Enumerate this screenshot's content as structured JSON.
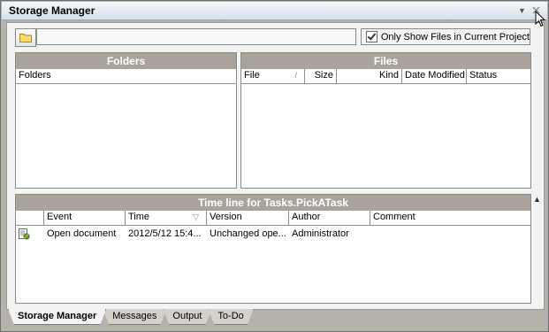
{
  "window": {
    "title": "Storage Manager"
  },
  "toolbar": {
    "path_value": "",
    "checkbox_label": "Only Show Files in Current Project",
    "checkbox_checked": true
  },
  "folders_panel": {
    "title": "Folders",
    "column": "Folders"
  },
  "files_panel": {
    "title": "Files",
    "columns": [
      "File",
      "Size",
      "Kind",
      "Date Modified",
      "Status"
    ]
  },
  "timeline_panel": {
    "title": "Time line for Tasks.PickATask",
    "columns": [
      "Event",
      "Time",
      "Version",
      "Author",
      "Comment"
    ],
    "rows": [
      {
        "icon": "document-edit-icon",
        "event": "Open document",
        "time": "2012/5/12 15:4...",
        "version": "Unchanged ope...",
        "author": "Administrator",
        "comment": ""
      }
    ]
  },
  "tabs": [
    {
      "label": "Storage Manager",
      "active": true
    },
    {
      "label": "Messages",
      "active": false
    },
    {
      "label": "Output",
      "active": false
    },
    {
      "label": "To-Do",
      "active": false
    }
  ],
  "colors": {
    "panel_header": "#a9a39b",
    "title_bar": "#d9dee8",
    "frame": "#b5b1ab"
  }
}
